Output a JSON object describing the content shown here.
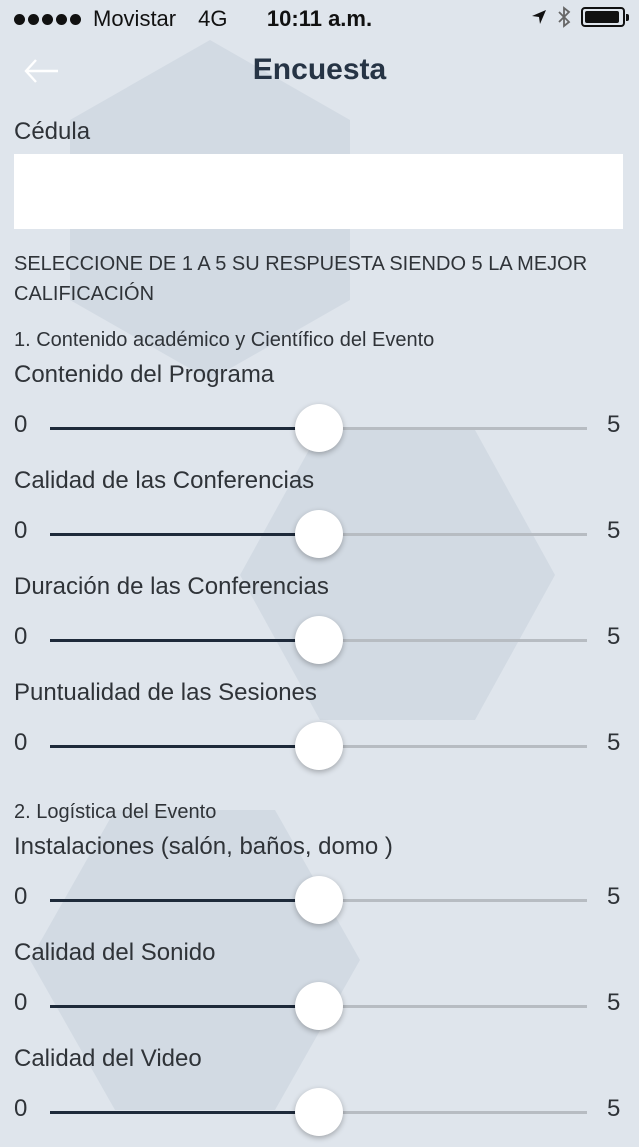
{
  "status_bar": {
    "carrier": "Movistar",
    "network": "4G",
    "time": "10:11 a.m.",
    "signal_bars": 5,
    "battery_level": 0.95,
    "icons": [
      "location-arrow-icon",
      "bluetooth-icon",
      "battery-icon"
    ]
  },
  "nav": {
    "back_icon": "arrow-left-icon",
    "title": "Encuesta"
  },
  "cedula": {
    "label": "Cédula",
    "value": "",
    "placeholder": ""
  },
  "instructions": "SELECCIONE DE 1 A 5 SU RESPUESTA SIENDO 5 LA MEJOR CALIFICACIÓN",
  "sections": [
    {
      "title": "1. Contenido académico y Científico del Evento",
      "questions": [
        {
          "label": "Contenido del Programa",
          "min": "0",
          "max": "5",
          "value": 2.5
        },
        {
          "label": "Calidad de las Conferencias",
          "min": "0",
          "max": "5",
          "value": 2.5
        },
        {
          "label": "Duración de las Conferencias",
          "min": "0",
          "max": "5",
          "value": 2.5
        },
        {
          "label": "Puntualidad de las Sesiones",
          "min": "0",
          "max": "5",
          "value": 2.5
        }
      ]
    },
    {
      "title": "2. Logística del Evento",
      "questions": [
        {
          "label": "Instalaciones (salón, baños, domo )",
          "min": "0",
          "max": "5",
          "value": 2.5
        },
        {
          "label": "Calidad del Sonido",
          "min": "0",
          "max": "5",
          "value": 2.5
        },
        {
          "label": "Calidad del Video",
          "min": "0",
          "max": "5",
          "value": 2.5
        }
      ]
    }
  ],
  "colors": {
    "background": "#dfe5ec",
    "title": "#263445",
    "slider_fill": "#1e2a3a",
    "slider_track": "#b7bcc2",
    "thumb": "#ffffff"
  }
}
